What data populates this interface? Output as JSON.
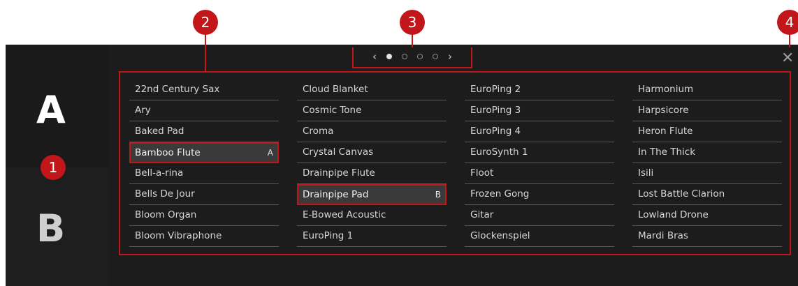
{
  "callouts": [
    "1",
    "2",
    "3",
    "4"
  ],
  "slots": {
    "a": "A",
    "b": "B"
  },
  "pager": {
    "prev": "‹",
    "next": "›",
    "pages": 4,
    "active_page": 1
  },
  "close_glyph": "✕",
  "columns": [
    [
      {
        "label": "22nd Century Sax"
      },
      {
        "label": "Ary"
      },
      {
        "label": "Baked Pad"
      },
      {
        "label": "Bamboo Flute",
        "tag": "A",
        "selected": true
      },
      {
        "label": "Bell-a-rina"
      },
      {
        "label": "Bells De Jour"
      },
      {
        "label": "Bloom Organ"
      },
      {
        "label": "Bloom Vibraphone"
      }
    ],
    [
      {
        "label": "Cloud Blanket"
      },
      {
        "label": "Cosmic Tone"
      },
      {
        "label": "Croma"
      },
      {
        "label": "Crystal Canvas"
      },
      {
        "label": "Drainpipe Flute"
      },
      {
        "label": "Drainpipe Pad",
        "tag": "B",
        "selected": true
      },
      {
        "label": "E-Bowed Acoustic"
      },
      {
        "label": "EuroPing 1"
      }
    ],
    [
      {
        "label": "EuroPing 2"
      },
      {
        "label": "EuroPing 3"
      },
      {
        "label": "EuroPing 4"
      },
      {
        "label": "EuroSynth 1"
      },
      {
        "label": "Floot"
      },
      {
        "label": "Frozen Gong"
      },
      {
        "label": "Gitar"
      },
      {
        "label": "Glockenspiel"
      }
    ],
    [
      {
        "label": "Harmonium"
      },
      {
        "label": "Harpsicore"
      },
      {
        "label": "Heron Flute"
      },
      {
        "label": "In The Thick"
      },
      {
        "label": "Isili"
      },
      {
        "label": "Lost Battle Clarion"
      },
      {
        "label": "Lowland Drone"
      },
      {
        "label": "Mardi Bras"
      }
    ]
  ],
  "colors": {
    "accent": "#c2161b",
    "panel": "#1c1c1c",
    "text": "#d6d6d6"
  }
}
